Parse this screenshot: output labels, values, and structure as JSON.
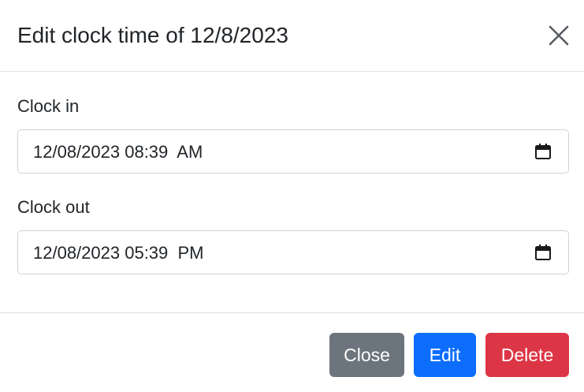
{
  "dialog": {
    "title": "Edit clock time of 12/8/2023"
  },
  "fields": {
    "clock_in": {
      "label": "Clock in",
      "value": "12/08/2023 08:39  AM"
    },
    "clock_out": {
      "label": "Clock out",
      "value": "12/08/2023 05:39  PM"
    }
  },
  "footer": {
    "close_label": "Close",
    "edit_label": "Edit",
    "delete_label": "Delete"
  },
  "icons": {
    "close": "close-x-icon",
    "calendar": "calendar-icon"
  },
  "colors": {
    "secondary": "#6c757d",
    "primary": "#0d6efd",
    "danger": "#dc3545"
  }
}
